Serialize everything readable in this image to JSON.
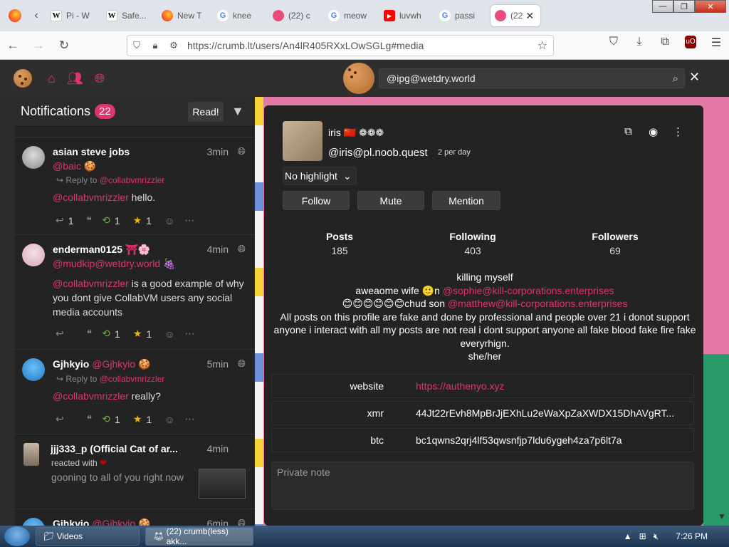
{
  "browser": {
    "tabs": [
      {
        "icon": "firefox-icon",
        "title": "",
        "fav": "ff"
      },
      {
        "icon": "wikipedia-icon",
        "title": "Pi - W",
        "fav": "w"
      },
      {
        "icon": "wikipedia-icon",
        "title": "Safe...",
        "fav": "w"
      },
      {
        "icon": "firefox-icon",
        "title": "New T",
        "fav": "ff"
      },
      {
        "icon": "google-icon",
        "title": "knee",
        "fav": "g"
      },
      {
        "icon": "crumb-icon",
        "title": "(22) c",
        "fav": "ck"
      },
      {
        "icon": "google-icon",
        "title": "meow",
        "fav": "g"
      },
      {
        "icon": "youtube-icon",
        "title": "luvwh",
        "fav": "yt"
      },
      {
        "icon": "google-icon",
        "title": "passi",
        "fav": "g"
      }
    ],
    "active_tab_title": "(22",
    "url": "https://crumb.lt/users/An4lR405RXxLOwSGLg#media"
  },
  "site": {
    "search_value": "@ipg@wetdry.world"
  },
  "notifications": {
    "title": "Notifications",
    "count": "22",
    "read_label": "Read!",
    "items": [
      {
        "name": "asian steve jobs",
        "time": "3min",
        "acct": "@baic",
        "reply_prefix": "Reply to",
        "reply_to": "@collabvmrizzler",
        "mention": "@collabvmrizzler",
        "text": " hello.",
        "replies": "1",
        "boosts": "1",
        "favs": "1"
      },
      {
        "name": "enderman0125",
        "time": "4min",
        "acct": "@mudkip@wetdry.world",
        "mention": "@collabvmrizzler",
        "text": " is a good example of why you dont give CollabVM users any social media accounts",
        "boosts": "1",
        "favs": "1"
      },
      {
        "name": "Gjhkyio",
        "handle": "@Gjhkyio",
        "time": "5min",
        "reply_prefix": "Reply to",
        "reply_to": "@collabvmrizzler",
        "mention": "@collabvmrizzler",
        "text": " really?",
        "boosts": "1",
        "favs": "1"
      },
      {
        "name": "jjj333_p (Official Cat of ar...",
        "time": "4min",
        "reacted": "reacted with",
        "text": "gooning to all of you right now"
      },
      {
        "name": "Gjhkyio",
        "handle": "@Gjhkyio",
        "time": "6min"
      }
    ]
  },
  "profile": {
    "name": "iris 🇨🇳 ❁❁❁",
    "handle": "@iris@pl.noob.quest",
    "per_day": "2 per day",
    "highlight": "No highlight",
    "follow": "Follow",
    "mute": "Mute",
    "mention": "Mention",
    "stats": [
      {
        "label": "Posts",
        "value": "185"
      },
      {
        "label": "Following",
        "value": "403"
      },
      {
        "label": "Followers",
        "value": "69"
      }
    ],
    "bio": {
      "line1": "killing myself",
      "line2_text": "aweaome wife 🙂n ",
      "line2_mention": "@sophie@kill-corporations.enterprises",
      "line3_text": "😊😊😊😊😊😊chud son ",
      "line3_mention": "@matthew@kill-corporations.enterprises",
      "line4": "All posts on this profile are fake and done by professional and people over 21 i donot support anyone i interact with all my posts are not real i dont support anyone all fake blood fake fire fake everyrhign.",
      "line5": "she/her"
    },
    "fields": [
      {
        "key": "website",
        "value": "https://authenyo.xyz",
        "link": true
      },
      {
        "key": "xmr",
        "value": "44Jt22rEvh8MpBrJjEXhLu2eWaXpZaXWDX15DhAVgRT...",
        "link": false
      },
      {
        "key": "btc",
        "value": "bc1qwns2qrj4lf53qwsnfjp7ldu6ygeh4za7p6lt7a",
        "link": false
      }
    ],
    "note_placeholder": "Private note"
  },
  "taskbar": {
    "items": [
      "Videos",
      "(22) crumb(less) akk..."
    ],
    "time": "7:26 PM"
  },
  "colors": {
    "accent": "#e0346f",
    "boost": "#6bb04c",
    "fav": "#f0b400"
  }
}
